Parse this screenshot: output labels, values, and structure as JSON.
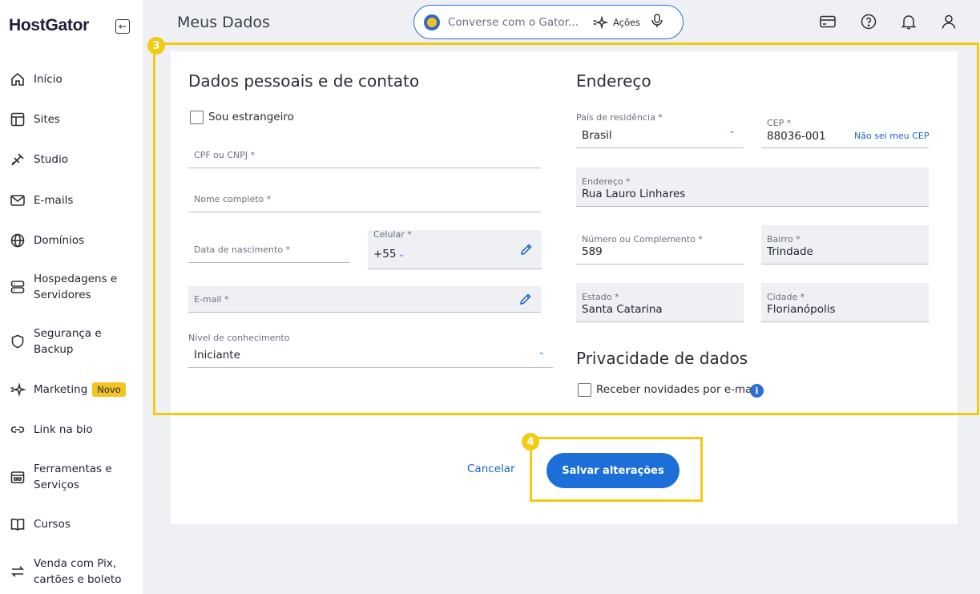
{
  "brand": {
    "logo": "HostGator",
    "collapse_icon": "arrow-left-icon"
  },
  "sidebar": {
    "items": [
      {
        "label": "Início",
        "icon": "home-icon"
      },
      {
        "label": "Sites",
        "icon": "layout-icon"
      },
      {
        "label": "Studio",
        "icon": "studio-icon"
      },
      {
        "label": "E-mails",
        "icon": "mail-icon"
      },
      {
        "label": "Domínios",
        "icon": "globe-icon"
      },
      {
        "label": "Hospedagens e Servidores",
        "icon": "server-icon"
      },
      {
        "label": "Segurança e Backup",
        "icon": "shield-icon"
      },
      {
        "label": "Marketing",
        "icon": "sparkle-icon",
        "badge": "Novo"
      },
      {
        "label": "Link na bio",
        "icon": "link-icon"
      },
      {
        "label": "Ferramentas e Serviços",
        "icon": "tools-icon"
      },
      {
        "label": "Cursos",
        "icon": "book-icon"
      },
      {
        "label": "Venda com Pix, cartões e boleto",
        "icon": "exchange-icon"
      }
    ]
  },
  "header": {
    "title": "Meus Dados",
    "chat_placeholder": "Converse com o Gator...",
    "actions_label": "Ações",
    "icons": [
      "card-icon",
      "help-icon",
      "bell-icon",
      "user-icon"
    ]
  },
  "personal": {
    "title": "Dados pessoais e de contato",
    "foreigner_label": "Sou estrangeiro",
    "cpf_label": "CPF ou CNPJ *",
    "name_label": "Nome completo *",
    "birth_label": "Data de nascimento *",
    "phone_label": "Celular *",
    "phone_value": "+55",
    "email_label": "E-mail *",
    "level_label": "Nível de conhecimento",
    "level_value": "Iniciante"
  },
  "address": {
    "title": "Endereço",
    "country_label": "País de residência *",
    "country_value": "Brasil",
    "cep_label": "CEP *",
    "cep_value": "88036-001",
    "cep_link": "Não sei meu CEP",
    "street_label": "Endereço *",
    "street_value": "Rua Lauro Linhares",
    "number_label": "Número ou Complemento *",
    "number_value": "589",
    "district_label": "Bairro *",
    "district_value": "Trindade",
    "state_label": "Estado *",
    "state_value": "Santa Catarina",
    "city_label": "Cidade *",
    "city_value": "Florianópolis"
  },
  "privacy": {
    "title": "Privacidade de dados",
    "newsletter_label": "Receber novidades por e-mail",
    "info": "i"
  },
  "actions": {
    "cancel": "Cancelar",
    "save": "Salvar alterações"
  },
  "annotations": {
    "step3": "3",
    "step4": "4"
  },
  "colors": {
    "accent": "#1b6fd6",
    "highlight": "#f2cb12",
    "badge": "#f2c41f"
  }
}
